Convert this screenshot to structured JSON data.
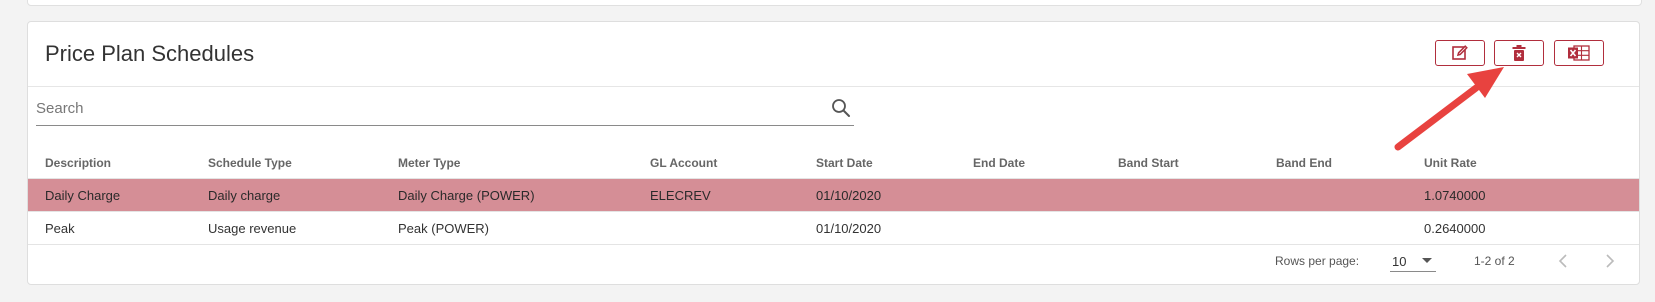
{
  "card": {
    "title": "Price Plan Schedules"
  },
  "toolbar": {
    "buttons": [
      {
        "icon": "edit-icon",
        "label": ""
      },
      {
        "icon": "delete-icon",
        "label": ""
      },
      {
        "icon": "excel-export-icon",
        "label": ""
      }
    ]
  },
  "search": {
    "placeholder": "Search",
    "value": ""
  },
  "table": {
    "columns": [
      "Description",
      "Schedule Type",
      "Meter Type",
      "GL Account",
      "Start Date",
      "End Date",
      "Band Start",
      "Band End",
      "Unit Rate"
    ],
    "rows": [
      {
        "selected": true,
        "cells": [
          "Daily Charge",
          "Daily charge",
          "Daily Charge (POWER)",
          "ELECREV",
          "01/10/2020",
          "",
          "",
          "",
          "1.0740000"
        ]
      },
      {
        "selected": false,
        "cells": [
          "Peak",
          "Usage revenue",
          "Peak (POWER)",
          "",
          "01/10/2020",
          "",
          "",
          "",
          "0.2640000"
        ]
      }
    ]
  },
  "pagination": {
    "rows_per_page_label": "Rows per page:",
    "rows_per_page_value": "10",
    "range_text": "1-2 of 2"
  },
  "colors": {
    "accent": "#b12e3d",
    "selected_row": "#d58e96",
    "annotation_arrow": "#e8423f"
  }
}
